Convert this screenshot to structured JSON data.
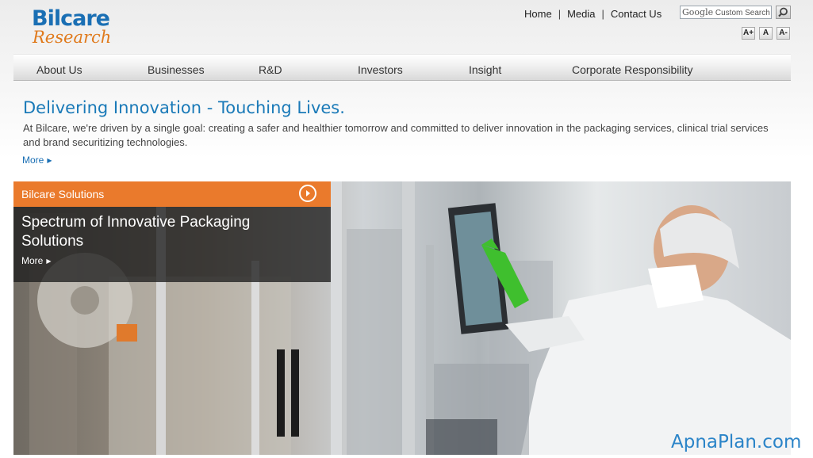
{
  "brand": {
    "name_top": "Bilcare",
    "name_bottom": "Research"
  },
  "top_links": [
    "Home",
    "Media",
    "Contact Us"
  ],
  "search": {
    "placeholder_brand": "Google",
    "placeholder_suffix": "Custom Search"
  },
  "font_size_buttons": [
    "A+",
    "A",
    "A-"
  ],
  "nav": [
    "About Us",
    "Businesses",
    "R&D",
    "Investors",
    "Insight",
    "Corporate Responsibility"
  ],
  "intro": {
    "headline": "Delivering Innovation - Touching Lives.",
    "body": "At Bilcare, we're driven by a single goal: creating a safer and healthier tomorrow and committed to deliver innovation in the packaging services, clinical trial services and brand securitizing technologies.",
    "more_label": "More"
  },
  "hero": {
    "category": "Bilcare Solutions",
    "heading": "Spectrum of Innovative Packaging Solutions",
    "more_label": "More"
  },
  "watermark": "ApnaPlan.com",
  "colors": {
    "brand_blue": "#1a6fb4",
    "brand_orange": "#ea7a2c"
  }
}
